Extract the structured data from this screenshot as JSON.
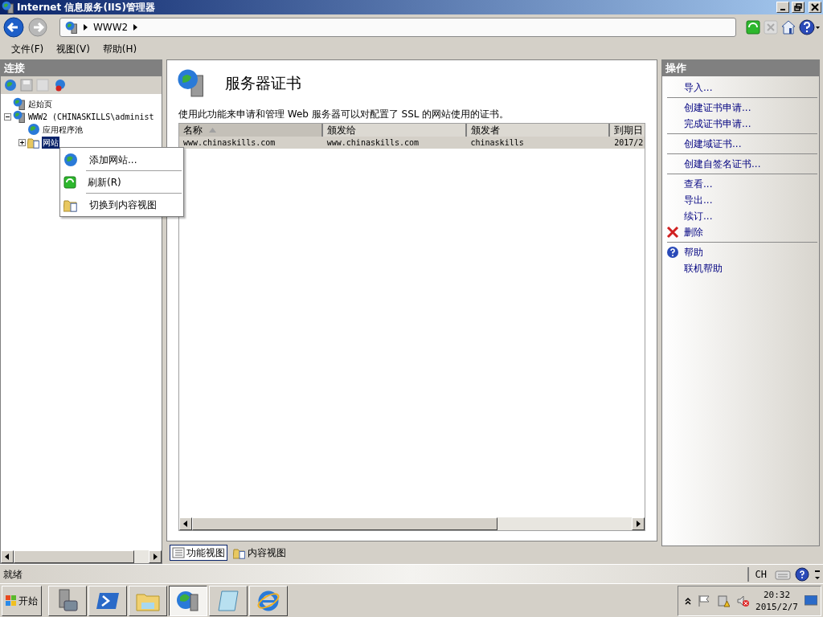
{
  "window": {
    "title": "Internet 信息服务(IIS)管理器"
  },
  "address": {
    "crumbs": [
      "WWW2"
    ]
  },
  "menu": [
    "文件(F)",
    "视图(V)",
    "帮助(H)"
  ],
  "connections": {
    "title": "连接",
    "tree": [
      {
        "label": "起始页",
        "selected": false
      },
      {
        "label": "WWW2 (CHINASKILLS\\administ",
        "selected": false,
        "expanded": true,
        "children": [
          {
            "label": "应用程序池",
            "selected": false
          },
          {
            "label": "网站",
            "selected": true,
            "expanded": false
          }
        ]
      }
    ]
  },
  "context_menu": [
    "添加网站...",
    "刷新(R)",
    "切换到内容视图"
  ],
  "feature": {
    "title": "服务器证书",
    "description": "使用此功能来申请和管理 Web 服务器可以对配置了 SSL 的网站使用的证书。",
    "columns": [
      {
        "label": "名称",
        "sorted": true
      },
      {
        "label": "颁发给",
        "sorted": false
      },
      {
        "label": "颁发者",
        "sorted": false
      },
      {
        "label": "到期日",
        "sorted": false
      }
    ],
    "rows": [
      {
        "selected": true,
        "cells": [
          "www.chinaskills.com",
          "www.chinaskills.com",
          "chinaskills",
          "2017/2"
        ]
      }
    ]
  },
  "view_tabs": [
    {
      "label": "功能视图",
      "selected": true
    },
    {
      "label": "内容视图",
      "selected": false
    }
  ],
  "actions": {
    "title": "操作",
    "groups": [
      [
        {
          "label": "导入...",
          "kind": "plain"
        }
      ],
      [
        {
          "label": "创建证书申请...",
          "kind": "plain"
        },
        {
          "label": "完成证书申请...",
          "kind": "plain"
        }
      ],
      [
        {
          "label": "创建域证书...",
          "kind": "plain"
        }
      ],
      [
        {
          "label": "创建自签名证书...",
          "kind": "plain"
        }
      ],
      [
        {
          "label": "查看...",
          "kind": "plain"
        },
        {
          "label": "导出...",
          "kind": "plain"
        },
        {
          "label": "续订...",
          "kind": "plain"
        },
        {
          "label": "删除",
          "kind": "delete"
        }
      ],
      [
        {
          "label": "帮助",
          "kind": "help"
        },
        {
          "label": "联机帮助",
          "kind": "plain"
        }
      ]
    ]
  },
  "status_bar": {
    "text": "就绪",
    "language": "CH"
  },
  "taskbar": {
    "start": "开始",
    "apps": [
      {
        "selected": false
      },
      {
        "selected": false
      },
      {
        "selected": false
      },
      {
        "selected": true
      },
      {
        "selected": false
      },
      {
        "selected": false
      }
    ],
    "time": "20:32",
    "date": "2015/2/7"
  }
}
